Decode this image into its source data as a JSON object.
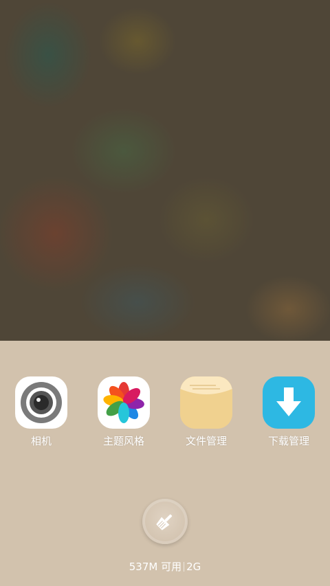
{
  "apps": [
    {
      "label": "相机",
      "icon": "camera-icon"
    },
    {
      "label": "主题风格",
      "icon": "theme-pinwheel-icon"
    },
    {
      "label": "文件管理",
      "icon": "folder-icon"
    },
    {
      "label": "下载管理",
      "icon": "download-arrow-icon"
    }
  ],
  "clean_button": {
    "icon": "broom-icon"
  },
  "memory": {
    "available": "537M 可用",
    "total": "2G"
  },
  "colors": {
    "panel_bg": "#d2c2ad",
    "download_blue": "#2db8e3",
    "folder_yellow": "#f0d18f"
  }
}
